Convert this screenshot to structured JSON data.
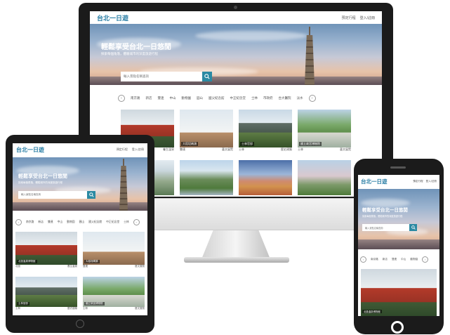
{
  "site": {
    "logo": "台北一日遊",
    "nav": [
      "預定行程",
      "登入/註冊"
    ],
    "hero_title": "輕鬆享受台北一日悠閒",
    "hero_subtitle": "探索每個角落，體驗城市的深度旅遊行程",
    "search_placeholder": "輸入景點名稱查詢",
    "tabs": [
      "南京路",
      "新店",
      "雙連",
      "中山",
      "動物園",
      "圓山",
      "國父紀念館",
      "中正紀念堂",
      "士林",
      "市政府",
      "台大醫院",
      "淡水"
    ],
    "cards": [
      {
        "badge": "北投溫泉博物館",
        "mrt": "北投",
        "category": "養生溫泉"
      },
      {
        "badge": "大稻埕碼頭",
        "mrt": "雙連",
        "category": "藝文展覽"
      },
      {
        "badge": "士林官邸",
        "mrt": "士林",
        "category": "歷史建築"
      },
      {
        "badge": "國立故宮博物院",
        "mrt": "士林",
        "category": "藝文展覽"
      },
      {
        "badge": "",
        "mrt": "",
        "category": ""
      },
      {
        "badge": "",
        "mrt": "",
        "category": ""
      },
      {
        "badge": "",
        "mrt": "",
        "category": ""
      },
      {
        "badge": "",
        "mrt": "",
        "category": ""
      }
    ]
  },
  "colors": {
    "brand": "#2b7fa6",
    "search_button": "#2b8aa3",
    "device_frame": "#1b1b1b"
  },
  "icons": {
    "search": "magnifier-icon",
    "prev": "chevron-left-icon",
    "next": "chevron-right-icon",
    "home": "home-button-icon"
  }
}
